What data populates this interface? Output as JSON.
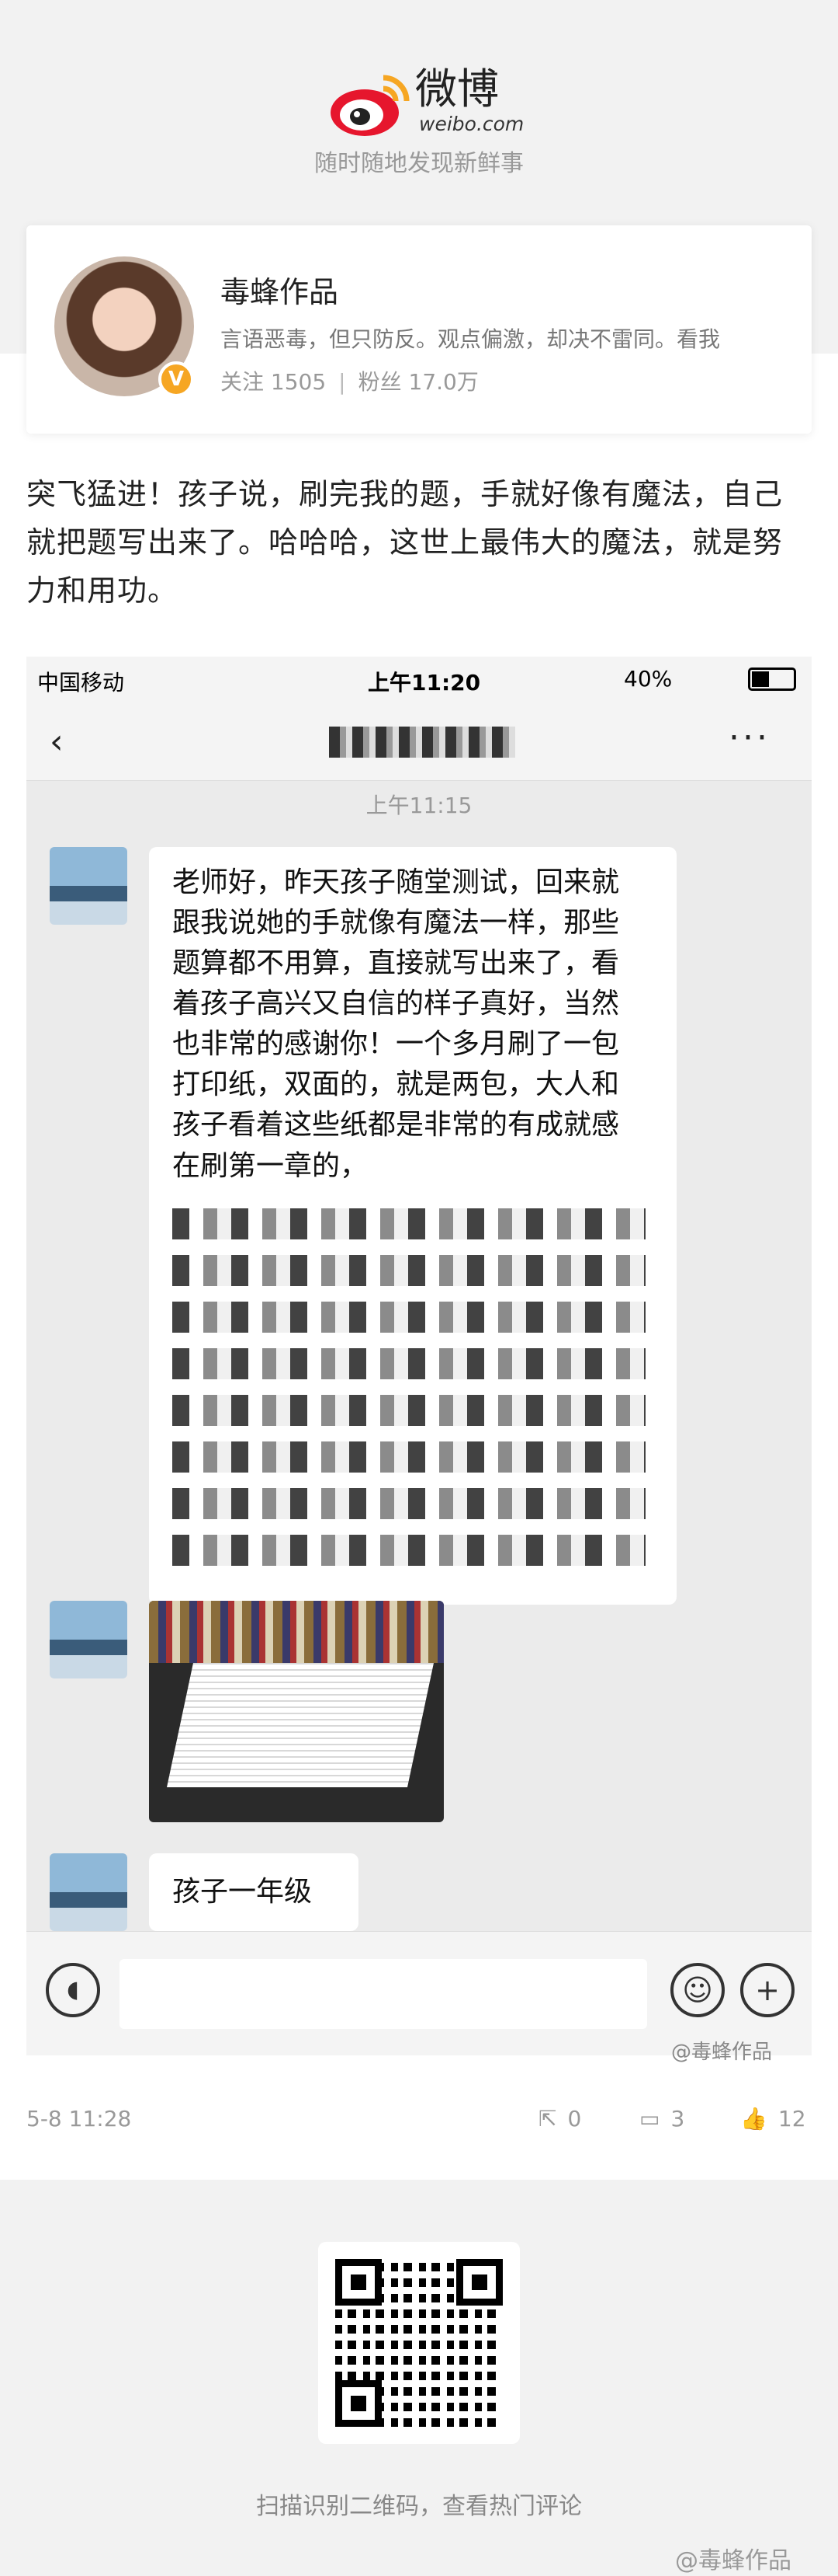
{
  "brand": {
    "logo_text": "微博",
    "logo_sub": "weibo.com",
    "slogan": "随时随地发现新鲜事"
  },
  "profile": {
    "name": "毒蜂作品",
    "bio": "言语恶毒，但只防反。观点偏激，却决不雷同。看我",
    "follow_label": "关注 1505",
    "fans_label": "粉丝 17.0万",
    "verified_icon": "v-badge-icon"
  },
  "post": {
    "text": "突飞猛进！孩子说，刷完我的题，手就好像有魔法，自己就把题写出来了。哈哈哈，这世上最伟大的魔法，就是努力和用功。"
  },
  "screenshot": {
    "status": {
      "carrier": "中国移动",
      "time": "上午11:20",
      "battery": "40%"
    },
    "chat_time": "上午11:15",
    "message1": "老师好，昨天孩子随堂测试，回来就跟我说她的手就像有魔法一样，那些题算都不用算，直接就写出来了，看着孩子高兴又自信的样子真好，当然也非常的感谢你！一个多月刷了一包打印纸，双面的，就是两包，大人和孩子看着这些纸都是非常的有成就感",
    "message1_partial": "在刷第一章的，",
    "message3": "孩子一年级",
    "watermark": "@毒蜂作品"
  },
  "meta": {
    "date": "5-8 11:28",
    "reposts": "0",
    "comments": "3",
    "likes": "12"
  },
  "footer": {
    "qr_hint": "扫描识别二维码，查看热门评论",
    "watermark": "@毒蜂作品"
  },
  "colors": {
    "accent": "#e6162d",
    "badge": "#f6a623"
  }
}
